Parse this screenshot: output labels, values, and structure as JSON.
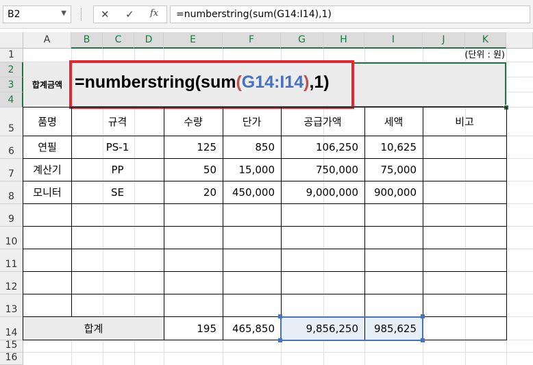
{
  "name_box": "B2",
  "formula_bar": {
    "cancel_icon": "✕",
    "enter_icon": "✓",
    "fx_icon": "fx",
    "formula": "=numberstring(sum(G14:I14),1)"
  },
  "columns": [
    "A",
    "B",
    "C",
    "D",
    "E",
    "F",
    "G",
    "H",
    "I",
    "J",
    "K"
  ],
  "rows": [
    "1",
    "2",
    "3",
    "4",
    "5",
    "6",
    "7",
    "8",
    "9",
    "10",
    "11",
    "12",
    "13",
    "14",
    "15",
    "16"
  ],
  "unit_note": "(단위 : 원)",
  "total_label": "합계금액",
  "big_formula": {
    "prefix": "=numberstring(sum",
    "open": "(",
    "ref": "G14:I14",
    "close": ")",
    "suffix": ",1)"
  },
  "headers": [
    "품명",
    "규격",
    "수량",
    "단가",
    "공급가액",
    "세액",
    "비고"
  ],
  "items": [
    {
      "name": "연필",
      "spec": "PS-1",
      "qty": "125",
      "price": "850",
      "supply": "106,250",
      "tax": "10,625"
    },
    {
      "name": "계산기",
      "spec": "PP",
      "qty": "50",
      "price": "15,000",
      "supply": "750,000",
      "tax": "75,000"
    },
    {
      "name": "모니터",
      "spec": "SE",
      "qty": "20",
      "price": "450,000",
      "supply": "9,000,000",
      "tax": "900,000"
    }
  ],
  "total_row": {
    "label": "합계",
    "qty": "195",
    "price": "465,850",
    "supply": "9,856,250",
    "tax": "985,625"
  },
  "colors": {
    "accent_green": "#217346",
    "highlight_red": "#e8242e",
    "ref_blue": "#4472c4",
    "paren_red": "#c0504d"
  }
}
